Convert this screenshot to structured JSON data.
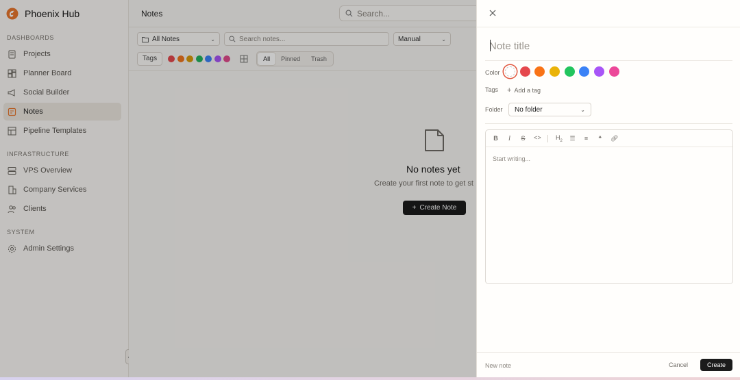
{
  "app": {
    "name": "Phoenix Hub"
  },
  "sidebar": {
    "sections": [
      {
        "label": "DASHBOARDS",
        "items": [
          {
            "label": "Projects",
            "icon": "file-icon"
          },
          {
            "label": "Planner Board",
            "icon": "board-icon"
          },
          {
            "label": "Social Builder",
            "icon": "megaphone-icon"
          },
          {
            "label": "Notes",
            "icon": "note-icon",
            "active": true
          },
          {
            "label": "Pipeline Templates",
            "icon": "template-icon"
          }
        ]
      },
      {
        "label": "INFRASTRUCTURE",
        "items": [
          {
            "label": "VPS Overview",
            "icon": "server-icon"
          },
          {
            "label": "Company Services",
            "icon": "building-icon"
          },
          {
            "label": "Clients",
            "icon": "users-icon"
          }
        ]
      },
      {
        "label": "SYSTEM",
        "items": [
          {
            "label": "Admin Settings",
            "icon": "gear-icon"
          }
        ]
      }
    ]
  },
  "header": {
    "title": "Notes",
    "search_placeholder": "Search..."
  },
  "toolbar": {
    "folder_filter": "All Notes",
    "search_placeholder": "Search notes...",
    "sort": "Manual",
    "tags_label": "Tags",
    "tag_colors": [
      "#e5484d",
      "#f0761e",
      "#d99a0b",
      "#22b35e",
      "#3b82f6",
      "#a855f7",
      "#e04b8c"
    ],
    "view_tabs": [
      "All",
      "Pinned",
      "Trash"
    ],
    "active_tab": "All"
  },
  "empty_state": {
    "title": "No notes yet",
    "subtitle": "Create your first note to get st",
    "button": "Create Note"
  },
  "drawer": {
    "title_placeholder": "Note title",
    "color_label": "Color",
    "colors": [
      "#ffffff",
      "#e5484d",
      "#f97316",
      "#eab308",
      "#22c55e",
      "#3b82f6",
      "#a855f7",
      "#ec4899"
    ],
    "tags_label": "Tags",
    "add_tag": "Add a tag",
    "folder_label": "Folder",
    "folder_value": "No folder",
    "editor_placeholder": "Start writing...",
    "status": "New note",
    "cancel": "Cancel",
    "create": "Create"
  }
}
